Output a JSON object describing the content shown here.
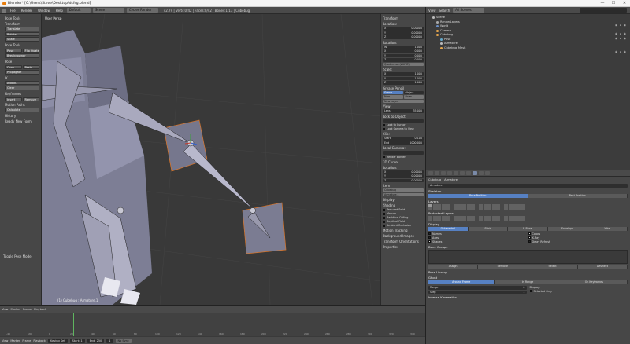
{
  "window": {
    "title": "Blender* [C:\\Users\\Steve\\Desktop\\dsfsg.blend]",
    "controls": [
      "—",
      "☐",
      "✕"
    ]
  },
  "menubar": {
    "items": [
      "File",
      "Render",
      "Window",
      "Help"
    ],
    "layout": "Default",
    "scene": "Scene",
    "engine": "Cycles Render",
    "stats": "v2.79 | Verts:0/42 | Faces:0/42 | Bones:1/13 | Cubebug"
  },
  "toolshelf": {
    "title": "Pose Tools",
    "transform_head": "Transform",
    "transform": [
      "Translate",
      "Rotate",
      "Scale"
    ],
    "pose_head": "Pose Tools",
    "pose_row1": [
      "Pose",
      "Flip Quats"
    ],
    "pose_row2": [
      "Breakdowner"
    ],
    "copy_head": "Pose",
    "copy_row": [
      "Copy",
      "Paste"
    ],
    "propagate": "Propagate",
    "ik_head": "IK",
    "ik_btns": [
      "Add IK",
      "Clear"
    ],
    "keyframes_head": "Keyframes",
    "key_row": [
      "Insert",
      "Remove"
    ],
    "motion_head": "Motion Paths",
    "calculate": "Calculate",
    "history_head": "History",
    "history": "Ready New Form",
    "bottom": "Toggle Pose Mode"
  },
  "viewport": {
    "label": "User Persp",
    "object": "(1) Cubebug : Armature.1"
  },
  "npanel": {
    "transform_head": "Transform",
    "location_head": "Location:",
    "loc": [
      [
        "X",
        "0.00000"
      ],
      [
        "Y",
        "0.00000"
      ],
      [
        "Z",
        "0.00000"
      ]
    ],
    "rotation_head": "Rotation:",
    "rot": [
      [
        "W",
        "1.000"
      ],
      [
        "X",
        "0.000"
      ],
      [
        "Y",
        "0.000"
      ],
      [
        "Z",
        "0.000"
      ]
    ],
    "mode": "Quaternion (WXYZ)",
    "scale_head": "Scale:",
    "scale": [
      [
        "X",
        "1.000"
      ],
      [
        "Y",
        "1.000"
      ],
      [
        "Z",
        "1.000"
      ]
    ],
    "grease_head": "Grease Pencil",
    "grease_tabs": [
      "Scene",
      "Object"
    ],
    "grease_btns": [
      "New",
      "Draw"
    ],
    "new_layer": "New Layer",
    "view_head": "View",
    "lens": [
      "Lens",
      "35.000"
    ],
    "lock_head": "Lock to Object:",
    "lock_cursor": "Lock to Cursor",
    "lock_camera": "Lock Camera to View",
    "clip_head": "Clip:",
    "start": [
      "Start",
      "0.100"
    ],
    "end": [
      "End",
      "1000.000"
    ],
    "local_cam": "Local Camera:",
    "render_border": "Render Border",
    "cursor_head": "3D Cursor",
    "cursor_loc": "Location:",
    "cursor": [
      [
        "X",
        "0.00000"
      ],
      [
        "Y",
        "0.00000"
      ],
      [
        "Z",
        "0.00000"
      ]
    ],
    "item_head": "Item",
    "item_name": "Cubebug",
    "item_bone": "Armature.1",
    "display_head": "Display",
    "shading_head": "Shading",
    "shading": [
      "Textured Solid",
      "Matcap",
      "Backface Culling",
      "Depth of Field",
      "Ambient Occlusion"
    ],
    "motion_head": "Motion Tracking",
    "bg_head": "Background Images",
    "orient_head": "Transform Orientations",
    "props_head": "Properties"
  },
  "outliner": {
    "header": [
      "View",
      "Search"
    ],
    "filter": "All Scenes",
    "items": [
      "Scene",
      "RenderLayers",
      "World",
      "Camera",
      "Cubebug",
      "Pose",
      "Armature",
      "Cubebug_Mesh"
    ]
  },
  "properties": {
    "path": [
      "Cubebug",
      "Armature"
    ],
    "name": "Armature",
    "skeleton_head": "Skeleton",
    "pose_tabs": [
      "Pose Position",
      "Rest Position"
    ],
    "layers_label": "Layers:",
    "protected_label": "Protected Layers:",
    "display_head": "Display",
    "display_tabs": [
      "Octahedral",
      "Stick",
      "B-Bone",
      "Envelope",
      "Wire"
    ],
    "checks_left": [
      "Names",
      "Axes",
      "Shapes"
    ],
    "checks_right": [
      "Colors",
      "X-Ray",
      "Delay Refresh"
    ],
    "groups_head": "Bone Groups",
    "group_btns": [
      "Assign",
      "Remove",
      "Select",
      "Deselect"
    ],
    "pose_lib_head": "Pose Library",
    "ghost_head": "Ghost",
    "ghost_tabs": [
      "Around Frame",
      "In Range",
      "On Keyframes"
    ],
    "range": [
      "Range",
      "0"
    ],
    "step": [
      "Step",
      "1"
    ],
    "display_label": "Display:",
    "selected_only": "Selected Only",
    "inverse_head": "Inverse Kinematics"
  },
  "timeline": {
    "menu": [
      "View",
      "Marker",
      "Frame",
      "Playback"
    ],
    "keying": "Keying Set",
    "start": "Start: 1",
    "end": "End: 250",
    "frame": "1",
    "sync": "No Sync",
    "ticks": [
      "-40",
      "-20",
      "0",
      "20",
      "40",
      "60",
      "80",
      "100",
      "120",
      "140",
      "160",
      "180",
      "200",
      "220",
      "240",
      "260",
      "280",
      "300",
      "320",
      "340"
    ]
  }
}
